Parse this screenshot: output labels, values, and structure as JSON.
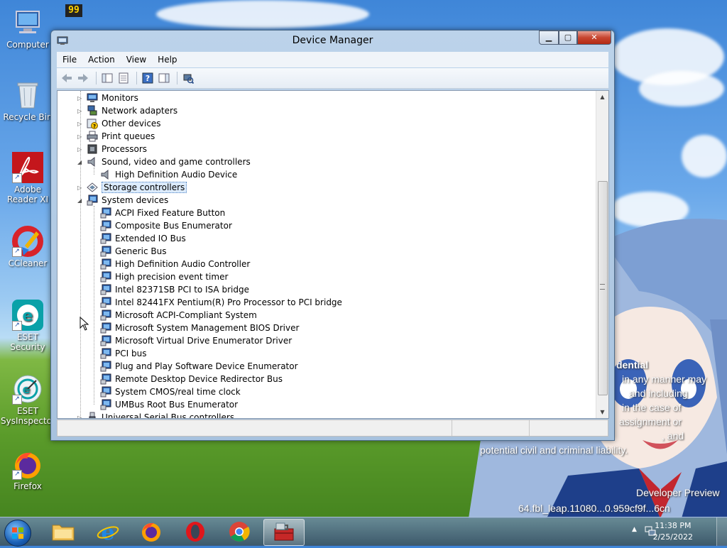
{
  "desktop": {
    "icons": [
      {
        "label": "Computer"
      },
      {
        "label": "Recycle Bin"
      },
      {
        "label": "Adobe Reader XI"
      },
      {
        "label": "CCleaner"
      },
      {
        "label": "ESET Security"
      },
      {
        "label": "ESET SysInspector"
      },
      {
        "label": "Firefox"
      }
    ],
    "top_widget": "99",
    "overlay_text": {
      "line1": "dential",
      "line2": "in any manner may",
      "line3": "and including",
      "line4": "in the case of",
      "line5": "assignment or",
      "line6": ", and",
      "line7": "potential civil and criminal liability.",
      "line8": "Developer Preview",
      "line9": "64.fbl_leap.11080...0.959cf9f...6cn"
    }
  },
  "window": {
    "title": "Device Manager",
    "menu": [
      "File",
      "Action",
      "View",
      "Help"
    ],
    "tree": [
      {
        "label": "Monitors",
        "level": 1,
        "expander": "▷",
        "icon": "monitor-icon"
      },
      {
        "label": "Network adapters",
        "level": 1,
        "expander": "▷",
        "icon": "network-icon"
      },
      {
        "label": "Other devices",
        "level": 1,
        "expander": "▷",
        "icon": "unknown-device-icon"
      },
      {
        "label": "Print queues",
        "level": 1,
        "expander": "▷",
        "icon": "printer-icon"
      },
      {
        "label": "Processors",
        "level": 1,
        "expander": "▷",
        "icon": "processor-icon"
      },
      {
        "label": "Sound, video and game controllers",
        "level": 1,
        "expander": "◢",
        "icon": "speaker-icon"
      },
      {
        "label": "High Definition Audio Device",
        "level": 2,
        "expander": "",
        "icon": "speaker-icon"
      },
      {
        "label": "Storage controllers",
        "level": 1,
        "expander": "▷",
        "icon": "storage-icon",
        "selected": true
      },
      {
        "label": "System devices",
        "level": 1,
        "expander": "◢",
        "icon": "system-icon"
      },
      {
        "label": "ACPI Fixed Feature Button",
        "level": 2,
        "expander": "",
        "icon": "system-icon"
      },
      {
        "label": "Composite Bus Enumerator",
        "level": 2,
        "expander": "",
        "icon": "system-icon"
      },
      {
        "label": "Extended IO Bus",
        "level": 2,
        "expander": "",
        "icon": "system-icon"
      },
      {
        "label": "Generic Bus",
        "level": 2,
        "expander": "",
        "icon": "system-icon"
      },
      {
        "label": "High Definition Audio Controller",
        "level": 2,
        "expander": "",
        "icon": "system-icon"
      },
      {
        "label": "High precision event timer",
        "level": 2,
        "expander": "",
        "icon": "system-icon"
      },
      {
        "label": "Intel 82371SB PCI to ISA bridge",
        "level": 2,
        "expander": "",
        "icon": "system-icon"
      },
      {
        "label": "Intel 82441FX Pentium(R) Pro Processor to PCI bridge",
        "level": 2,
        "expander": "",
        "icon": "system-icon"
      },
      {
        "label": "Microsoft ACPI-Compliant System",
        "level": 2,
        "expander": "",
        "icon": "system-icon"
      },
      {
        "label": "Microsoft System Management BIOS Driver",
        "level": 2,
        "expander": "",
        "icon": "system-icon"
      },
      {
        "label": "Microsoft Virtual Drive Enumerator Driver",
        "level": 2,
        "expander": "",
        "icon": "system-icon"
      },
      {
        "label": "PCI bus",
        "level": 2,
        "expander": "",
        "icon": "system-icon"
      },
      {
        "label": "Plug and Play Software Device Enumerator",
        "level": 2,
        "expander": "",
        "icon": "system-icon"
      },
      {
        "label": "Remote Desktop Device Redirector Bus",
        "level": 2,
        "expander": "",
        "icon": "system-icon"
      },
      {
        "label": "System CMOS/real time clock",
        "level": 2,
        "expander": "",
        "icon": "system-icon"
      },
      {
        "label": "UMBus Root Bus Enumerator",
        "level": 2,
        "expander": "",
        "icon": "system-icon"
      },
      {
        "label": "Universal Serial Bus controllers",
        "level": 1,
        "expander": "▷",
        "icon": "usb-icon"
      }
    ]
  },
  "taskbar": {
    "clock_time": "11:38 PM",
    "clock_date": "2/25/2022"
  },
  "colors": {
    "selection": "#dcebfc",
    "title_close": "#c7452f"
  }
}
